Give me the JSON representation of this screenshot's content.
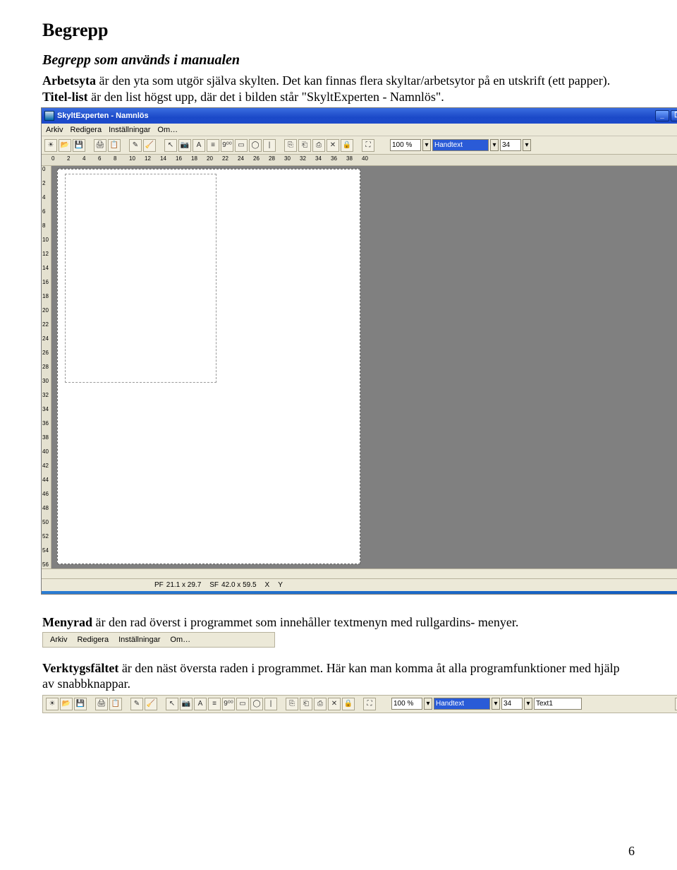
{
  "doc": {
    "heading": "Begrepp",
    "subheading": "Begrepp som används i manualen",
    "para1_a": "Arbetsyta",
    "para1_b": " är den yta som utgör själva skylten. Det kan finnas flera skyltar/arbetsytor på en utskrift (ett papper). ",
    "para1_c": "Titel-list",
    "para1_d": " är den list högst upp, där det i bilden står \"SkyltExperten - Namnlös\".",
    "para2_a": "Menyrad",
    "para2_b": " är den rad överst i programmet som innehåller textmenyn med rullgardins- menyer.",
    "para3_a": "Verktygsfältet",
    "para3_b": " är den näst översta raden i programmet. Här kan man komma åt alla programfunktioner med hjälp av snabbknappar.",
    "page_number": "6"
  },
  "app": {
    "title": "SkyltExperten - Namnlös",
    "menu": [
      "Arkiv",
      "Redigera",
      "Inställningar",
      "Om…"
    ],
    "zoom": "100 %",
    "font": "Handtext",
    "font_size": "34",
    "textfield": "Text1",
    "ruler_h": [
      "0",
      "2",
      "4",
      "6",
      "8",
      "10",
      "12",
      "14",
      "16",
      "18",
      "20",
      "22",
      "24",
      "26",
      "28",
      "30",
      "32",
      "34",
      "36",
      "38",
      "40"
    ],
    "ruler_v": [
      "0",
      "2",
      "4",
      "6",
      "8",
      "10",
      "12",
      "14",
      "16",
      "18",
      "20",
      "22",
      "24",
      "26",
      "28",
      "30",
      "32",
      "34",
      "36",
      "38",
      "40",
      "42",
      "44",
      "46",
      "48",
      "50",
      "52",
      "54",
      "56"
    ],
    "status": {
      "pf_label": "PF",
      "pf_val": "21.1 x 29.7",
      "sf_label": "SF",
      "sf_val": "42.0 x 59.5",
      "x_label": "X",
      "y_label": "Y"
    },
    "icons": [
      "☀",
      "📂",
      "💾",
      "",
      "🖨",
      "📋",
      "",
      "✎",
      "🧹",
      "",
      "↖",
      "📷",
      "A",
      "≡",
      "9⁰⁰",
      "▭",
      "◯",
      "|",
      "",
      "⎘",
      "⎗",
      "⎙",
      "✕",
      "🔒",
      "",
      "⛶"
    ],
    "icons_strip": [
      "☀",
      "📂",
      "💾",
      "",
      "🖨",
      "📋",
      "",
      "✎",
      "🧹",
      "",
      "↖",
      "📷",
      "A",
      "≡",
      "9⁰⁰",
      "▭",
      "◯",
      "|",
      "",
      "⎘",
      "⎗",
      "⎙",
      "✕",
      "🔒",
      "",
      "⛶"
    ],
    "win_min": "_",
    "win_max": "❐",
    "win_close": "✕"
  }
}
